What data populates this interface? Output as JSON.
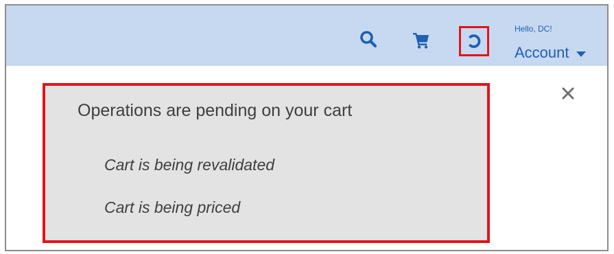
{
  "header": {
    "greeting": "Hello, DC!",
    "account_label": "Account",
    "icons": {
      "search": "search-icon",
      "cart": "cart-icon",
      "loading": "loading-spinner-icon",
      "account_menu": "caret-down-icon"
    }
  },
  "notice": {
    "title": "Operations are pending on your cart",
    "items": [
      "Cart is being revalidated",
      "Cart is being priced"
    ],
    "close_icon": "close-icon"
  },
  "colors": {
    "header_bg": "#c7d9f0",
    "accent_blue": "#1f5fb4",
    "highlight_red": "#e0141b",
    "panel_bg": "#e3e3e3"
  }
}
